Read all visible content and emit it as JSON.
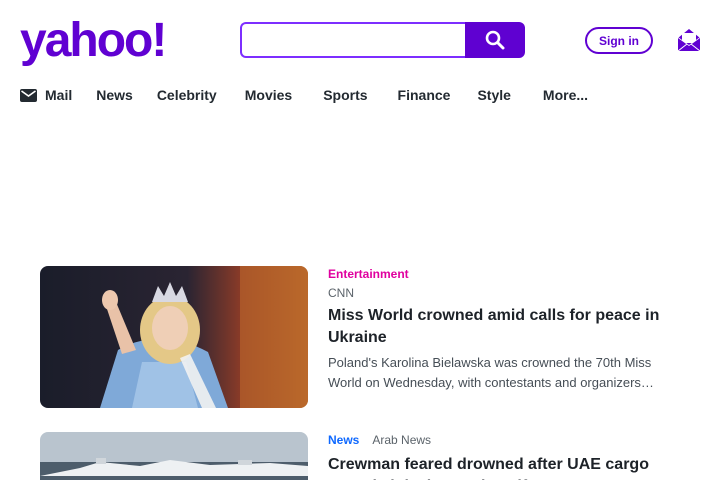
{
  "header": {
    "logo_text": "yahoo!",
    "brand_color": "#6001d2",
    "search": {
      "placeholder": "",
      "value": "",
      "button_icon": "search-icon"
    },
    "signin_label": "Sign in",
    "mail_icon": "mail-envelope-icon"
  },
  "nav": {
    "items": [
      {
        "label": "Mail",
        "icon": "mail-icon"
      },
      {
        "label": "News"
      },
      {
        "label": "Celebrity"
      },
      {
        "label": "Movies"
      },
      {
        "label": "Sports"
      },
      {
        "label": "Finance"
      },
      {
        "label": "Style"
      },
      {
        "label": "More..."
      }
    ]
  },
  "stories": [
    {
      "category": "Entertainment",
      "category_color": "#e0009f",
      "source": "CNN",
      "headline": "Miss World crowned amid calls for peace in Ukraine",
      "summary": "Poland's Karolina Bielawska was crowned the 70th Miss World on Wednesday, with contestants and organizers…"
    },
    {
      "category": "News",
      "category_color": "#0f69ff",
      "source": "Arab News",
      "headline": "Crewman feared drowned after UAE cargo vessel sinks in rough Gulf seas"
    }
  ]
}
